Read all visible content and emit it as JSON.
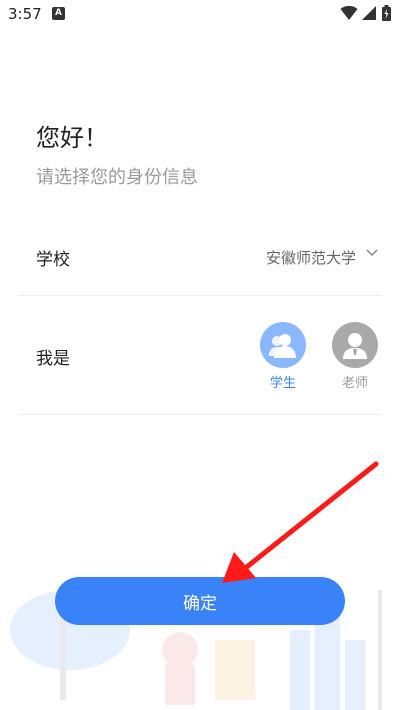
{
  "status_bar": {
    "time": "3:57",
    "indicator": "A"
  },
  "header": {
    "greeting": "您好！",
    "subtitle": "请选择您的身份信息"
  },
  "school": {
    "label": "学校",
    "value": "安徽师范大学"
  },
  "role": {
    "label": "我是",
    "options": [
      {
        "label": "学生",
        "selected": true,
        "color": "#3a82f7"
      },
      {
        "label": "老师",
        "selected": false,
        "color": "#a9a9a9"
      }
    ]
  },
  "confirm": {
    "label": "确定",
    "color": "#3a82f7"
  },
  "annotation": {
    "arrow_color": "#ff0000"
  }
}
